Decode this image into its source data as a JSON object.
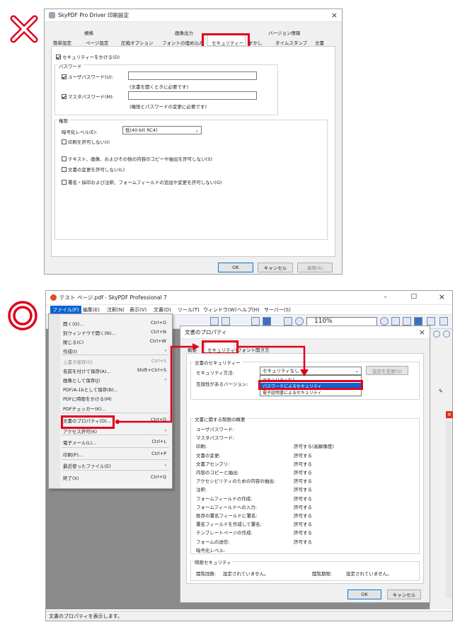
{
  "colors": {
    "red": "#e0001a",
    "accent": "#0078d7",
    "select": "#0a64d2"
  },
  "wrong_mark": {
    "icon": "x-mark-icon"
  },
  "right_mark": {
    "icon": "double-circle-icon"
  },
  "dlg1": {
    "title": "SkyPDF Pro Driver 印刷設定",
    "close": "×",
    "tabs_top": [
      "規格",
      "画像出力",
      "バージョン情報"
    ],
    "tabs_bottom": [
      "簡単設定",
      "ページ設定",
      "圧縮オプション",
      "フォントの埋め込み",
      "セキュリティー",
      "すかし",
      "タイムスタンプ",
      "文書"
    ],
    "enable_security": "セキュリティーをかける(D)",
    "password_group": "パスワード",
    "user_pw": "ユーザパスワード(U):",
    "user_pw_note": "(文書を開くときに必要です)",
    "master_pw": "マスタパスワード(M):",
    "master_pw_note": "(権限とパスワードの変更に必要です)",
    "perm_group": "権限",
    "enc_level": "暗号化レベル(E):",
    "enc_value": "低(40-bit RC4)",
    "perm_items": [
      "印刷を許可しない(I)",
      "テキスト、画像、およびその他の内容のコピーや抽出を許可しない(S)",
      "文書の変更を許可しない(L)",
      "署名・採印および注釈、フォームフィールドの追加や変更を許可しない(G)"
    ],
    "ok": "OK",
    "cancel": "キャンセル",
    "apply": "適用(A)"
  },
  "app": {
    "title": "テスト ページ.pdf - SkyPDF Professional 7",
    "controls": [
      "–",
      "□",
      "×"
    ],
    "menubar": [
      "ファイル(F)",
      "編集(E)",
      "注釈(N)",
      "表示(V)",
      "文書(D)",
      "ツール(T)",
      "ウィンドウ(W)",
      "ヘルプ(H)",
      "サーバー(S)"
    ],
    "zoom": "110%",
    "status": "文書のプロパティを表示します。"
  },
  "file_menu": [
    {
      "label": "開く(O)...",
      "shortcut": "Ctrl+O"
    },
    {
      "label": "別ウィンドウで開く(N)...",
      "shortcut": "Ctrl+N"
    },
    {
      "label": "閉じる(C)",
      "shortcut": "Ctrl+W"
    },
    {
      "label": "作成(I)",
      "shortcut": "›"
    },
    {
      "label": "上書き保存(S)",
      "shortcut": "Ctrl+S"
    },
    {
      "label": "名前を付けて保存(A)...",
      "shortcut": "Shift+Ctrl+S"
    },
    {
      "label": "画像として保存(J)",
      "shortcut": "›"
    },
    {
      "label": "PDF/A-1bとして保存(B)...",
      "shortcut": ""
    },
    {
      "label": "PDFに時限をかける(M)",
      "shortcut": ""
    },
    {
      "label": "PDFチェッカー(K)...",
      "shortcut": ""
    },
    {
      "label": "文書のプロパティ(D)...",
      "shortcut": "Ctrl+D"
    },
    {
      "label": "アクセス許可(K)",
      "shortcut": "›"
    },
    {
      "label": "電子メール(L)...",
      "shortcut": "Ctrl+L"
    },
    {
      "label": "印刷(P)...",
      "shortcut": "Ctrl+P"
    },
    {
      "label": "最近使ったファイル(E)",
      "shortcut": "›"
    },
    {
      "label": "終了(X)",
      "shortcut": "Ctrl+Q"
    }
  ],
  "props": {
    "title": "文書のプロパティ",
    "close": "×",
    "tabs": [
      "概要",
      "セキュリティー",
      "フォント",
      "開き方"
    ],
    "sec_group": "文書のセキュリティー",
    "method_label": "セキュリティ方法:",
    "method_value": "セキュリティなし",
    "change_btn": "設定を変更(S)",
    "compat_label": "互換性があるバージョン:",
    "dropdown": [
      "セキュリティなし",
      "パスワードによるセキュリティ",
      "電子証明書によるセキュリティ"
    ],
    "summary_group": "文書に関する制限の概要",
    "summary": [
      {
        "k": "ユーザパスワード:",
        "v": ""
      },
      {
        "k": "マスタパスワード:",
        "v": ""
      },
      {
        "k": "印刷:",
        "v": "許可する(高解像度)"
      },
      {
        "k": "文書の変更:",
        "v": "許可する"
      },
      {
        "k": "文書アセンブリ:",
        "v": "許可する"
      },
      {
        "k": "内容のコピーと抽出:",
        "v": "許可する"
      },
      {
        "k": "アクセシビリティのための内容の抽出:",
        "v": "許可する"
      },
      {
        "k": "注釈:",
        "v": "許可する"
      },
      {
        "k": "フォームフィールドの作成:",
        "v": "許可する"
      },
      {
        "k": "フォームフィールドへの入力:",
        "v": "許可する"
      },
      {
        "k": "既存の署名フィールドに署名:",
        "v": "許可する"
      },
      {
        "k": "署名フィールドを作成して署名:",
        "v": "許可する"
      },
      {
        "k": "テンプレートページの作成:",
        "v": "許可する"
      },
      {
        "k": "フォームの送信:",
        "v": "許可する"
      },
      {
        "k": "暗号化レベル:",
        "v": ""
      }
    ],
    "time_group": "時限セキュリティ",
    "time_k1": "閲覧回数:",
    "time_v1": "設定されていません。",
    "time_k2": "閲覧期限:",
    "time_v2": "設定されていません。",
    "ok": "OK",
    "cancel": "キャンセル"
  }
}
